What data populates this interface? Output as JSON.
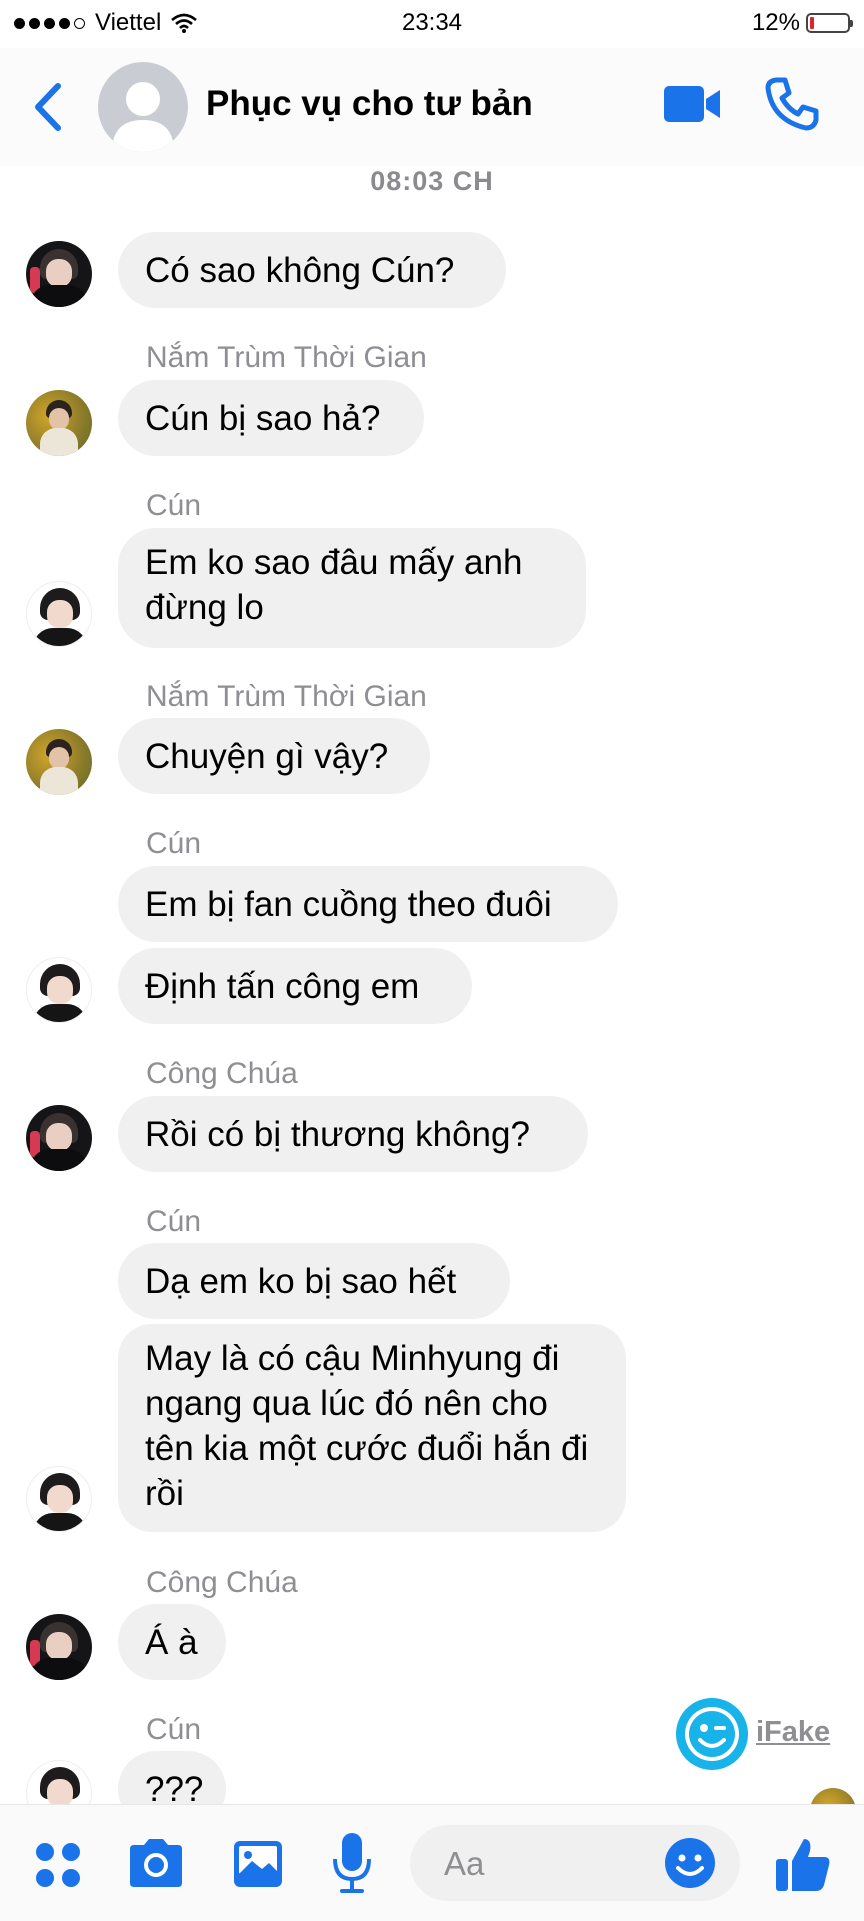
{
  "status_bar": {
    "carrier": "Viettel",
    "time": "23:34",
    "battery": "12%",
    "battery_level": 0.12,
    "signal_bars": 4
  },
  "header": {
    "title": "Phục vụ cho tư bản",
    "back_icon": "chevron-left-icon",
    "video_icon": "video-camera-icon",
    "call_icon": "phone-icon"
  },
  "timestamp": "08:03 CH",
  "messages": [
    {
      "text": "Có sao không Cún?"
    },
    {
      "sender": "Nắm Trùm Thời Gian",
      "text": "Cún bị sao hả?"
    },
    {
      "sender": "Cún",
      "text": "Em ko sao đâu mấy anh đừng lo"
    },
    {
      "sender": "Nắm Trùm Thời Gian",
      "text": "Chuyện gì vậy?"
    },
    {
      "sender": "Cún",
      "text": "Em bị fan cuồng theo đuôi"
    },
    {
      "text": "Định tấn công em"
    },
    {
      "sender": "Công Chúa",
      "text": "Rồi có bị thương không?"
    },
    {
      "sender": "Cún",
      "text": "Dạ em ko bị sao hết"
    },
    {
      "text": "May là có cậu Minhyung đi ngang qua lúc đó nên cho tên kia một cước đuổi hắn đi rồi"
    },
    {
      "sender": "Công Chúa",
      "text": "Á à"
    },
    {
      "sender": "Cún",
      "text": "???"
    }
  ],
  "watermark": {
    "text": "iFake"
  },
  "composer": {
    "placeholder": "Aa"
  },
  "toolbar": {
    "icons": [
      "apps-icon",
      "camera-icon",
      "image-icon",
      "microphone-icon",
      "emoji-icon",
      "thumbs-up-icon"
    ]
  },
  "colors": {
    "accent": "#1a73e8",
    "bubble": "#f1f0f0",
    "meta": "#8e8e93",
    "battery_low": "#e0242a"
  }
}
